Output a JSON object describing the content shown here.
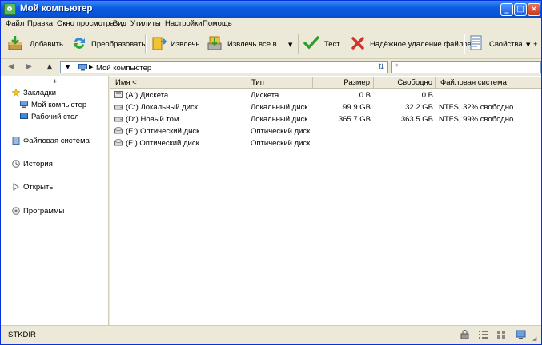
{
  "window": {
    "title": "Мой компьютер"
  },
  "menu": [
    "Файл",
    "Правка",
    "Окно просмотра",
    "Вид",
    "Утилиты",
    "Настройки",
    "Помощь"
  ],
  "toolbar": {
    "add": "Добавить",
    "convert": "Преобразовать",
    "extract": "Извлечь",
    "extract_all": "Извлечь все в...",
    "test": "Тест",
    "secure_delete": "Надёжное удаление файлов",
    "properties": "Свойства",
    "more": "+"
  },
  "address": {
    "path": "Мой компьютер",
    "search_placeholder": "*"
  },
  "left_panel": {
    "add": "+",
    "bookmarks": "Закладки",
    "my_computer": "Мой компьютер",
    "desktop": "Рабочий стол",
    "file_system": "Файловая система",
    "history": "История",
    "open": "Открыть",
    "programs": "Программы"
  },
  "columns": {
    "name": "Имя <",
    "type": "Тип",
    "size": "Размер",
    "free": "Свободно",
    "fs": "Файловая система"
  },
  "rows": [
    {
      "name": "(A:) Дискета",
      "type": "Дискета",
      "size": "0 B",
      "free": "0 B",
      "fs": ""
    },
    {
      "name": "(C:) Локальный диск",
      "type": "Локальный диск",
      "size": "99.9 GB",
      "free": "32.2 GB",
      "fs": "NTFS, 32% свободно"
    },
    {
      "name": "(D:) Новый том",
      "type": "Локальный диск",
      "size": "365.7 GB",
      "free": "363.5 GB",
      "fs": "NTFS, 99% свободно"
    },
    {
      "name": "(E:) Оптический диск",
      "type": "Оптический диск",
      "size": "",
      "free": "",
      "fs": ""
    },
    {
      "name": "(F:) Оптический диск",
      "type": "Оптический диск",
      "size": "",
      "free": "",
      "fs": ""
    }
  ],
  "status": {
    "text": "STKDIR"
  }
}
